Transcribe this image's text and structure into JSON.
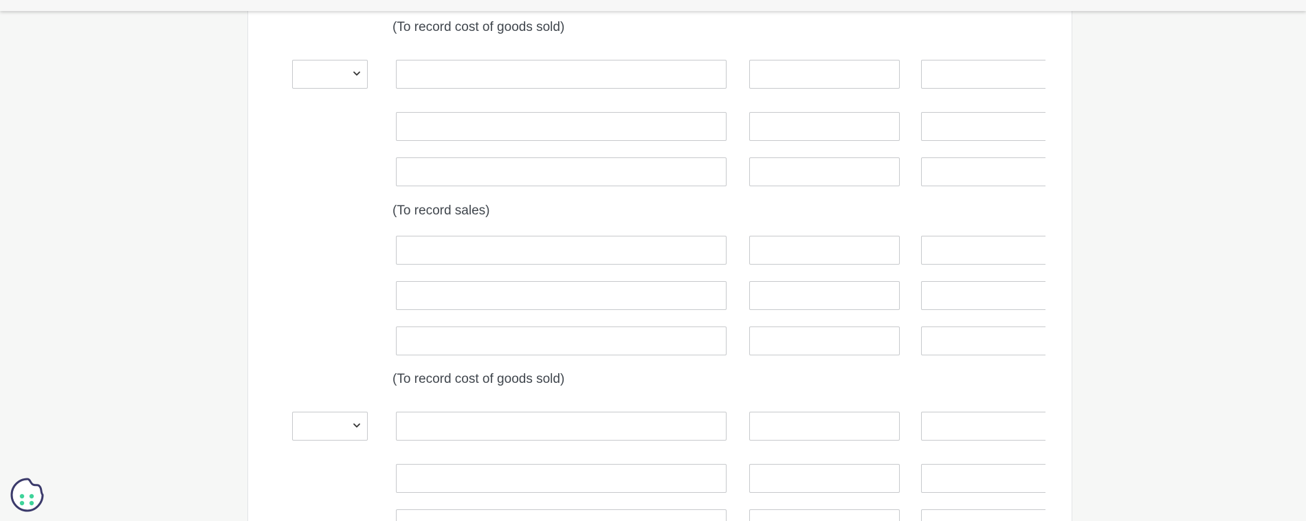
{
  "journal": {
    "captions": {
      "cogs_top": "(To record cost of goods sold)",
      "sales": "(To record sales)",
      "cogs_bottom": "(To record cost of goods sold)"
    },
    "entries": {
      "entry_3": {
        "date": "",
        "lines": [
          {
            "account": "",
            "debit": "",
            "credit": ""
          },
          {
            "account": "",
            "debit": "",
            "credit": ""
          },
          {
            "account": "",
            "debit": "",
            "credit": ""
          }
        ]
      },
      "entry_3_cogs": {
        "lines": [
          {
            "account": "",
            "debit": "",
            "credit": ""
          },
          {
            "account": "",
            "debit": "",
            "credit": ""
          },
          {
            "account": "",
            "debit": "",
            "credit": ""
          }
        ]
      },
      "entry_4": {
        "date": "",
        "lines": [
          {
            "account": "",
            "debit": "",
            "credit": ""
          },
          {
            "account": "",
            "debit": "",
            "credit": ""
          },
          {
            "account": "",
            "debit": "",
            "credit": ""
          }
        ]
      }
    }
  },
  "colors": {
    "page_background": "#f6f7f6",
    "card_background": "#ffffff",
    "input_border": "#c7c9cc",
    "cookie_outline": "#3b3a6b",
    "cookie_dots": "#3fd39a"
  },
  "icons": {
    "dropdown": "chevron-down-icon",
    "cookie": "cookie-icon"
  }
}
